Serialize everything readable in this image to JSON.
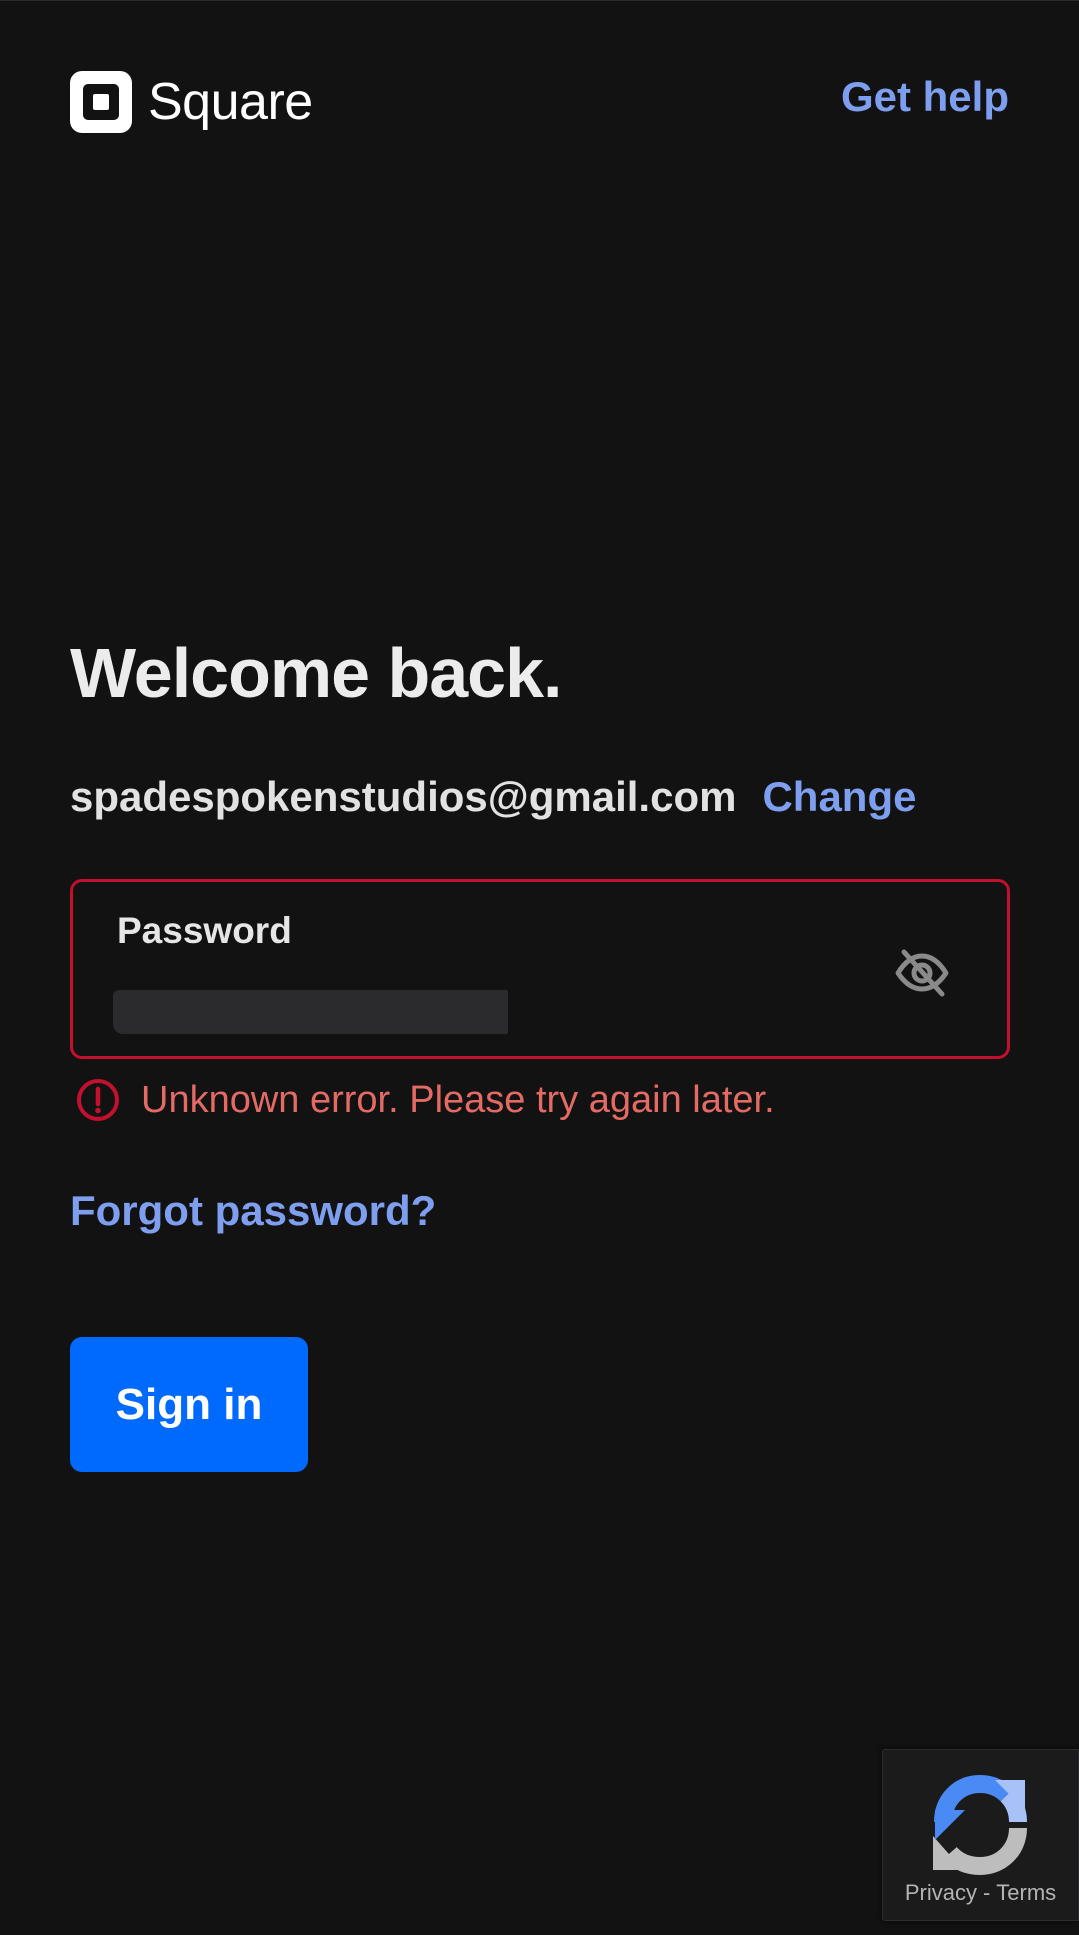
{
  "header": {
    "brand_name": "Square",
    "help_link": "Get help"
  },
  "main": {
    "title": "Welcome back.",
    "email": "spadespokenstudios@gmail.com",
    "change_link": "Change",
    "password": {
      "label": "Password",
      "visibility_icon": "eye-off-icon"
    },
    "error": {
      "icon": "alert-circle-icon",
      "message": "Unknown error. Please try again later."
    },
    "forgot_link": "Forgot password?",
    "sign_in_button": "Sign in"
  },
  "recaptcha": {
    "privacy": "Privacy",
    "separator": "-",
    "terms": "Terms"
  },
  "colors": {
    "background": "#121213",
    "link": "#7e9ff0",
    "error": "#c2102e",
    "error_text": "#e46a64",
    "primary_button": "#006aff"
  }
}
